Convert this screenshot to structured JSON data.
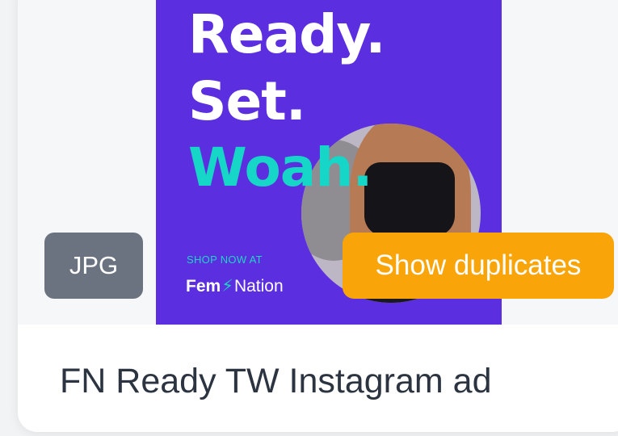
{
  "asset": {
    "format_badge": "JPG",
    "title": "FN Ready TW Instagram ad",
    "show_duplicates_label": "Show duplicates"
  },
  "ad_creative": {
    "headline_line1": "Ready.",
    "headline_line2": "Set.",
    "headline_line3": "Woah.",
    "shop_text": "SHOP NOW AT",
    "brand_fem": "Fem",
    "brand_nation": "Nation",
    "colors": {
      "background": "#5b2ee0",
      "accent": "#16d6c7"
    }
  },
  "colors": {
    "badge": "#6b7280",
    "duplicates_button": "#f9a50a",
    "title_text": "#2b3440"
  }
}
